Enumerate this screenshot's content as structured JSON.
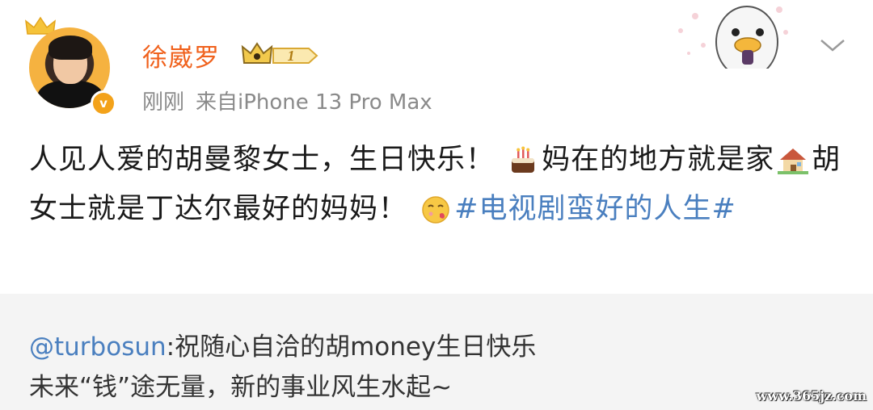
{
  "author": {
    "name": "徐崴罗",
    "level": "1",
    "avatar_icon": "avatar-photo",
    "verified_icon": "verified-badge-icon"
  },
  "meta": {
    "time": "刚刚",
    "source": "来自iPhone 13 Pro Max"
  },
  "post": {
    "part1": "人见人爱的胡曼黎女士，生日快乐！",
    "emoji1": "cake-icon",
    "part2": "妈在的地方就是家",
    "emoji2": "house-icon",
    "part3": "胡女士就是丁达尔最好的妈妈！",
    "emoji3": "kiss-face-icon",
    "hashtag": "#电视剧蛮好的人生#"
  },
  "repost": {
    "mention": "@turbosun",
    "line1_rest": ":祝随心自洽的胡money生日快乐",
    "line2": "未来“钱”途无量，新的事业风生水起~"
  },
  "watermark": "www.365jz.com",
  "colors": {
    "username": "#f0611c",
    "link": "#4a7fbf",
    "meta": "#8a8a8a",
    "repost_bg": "#f4f4f4"
  }
}
